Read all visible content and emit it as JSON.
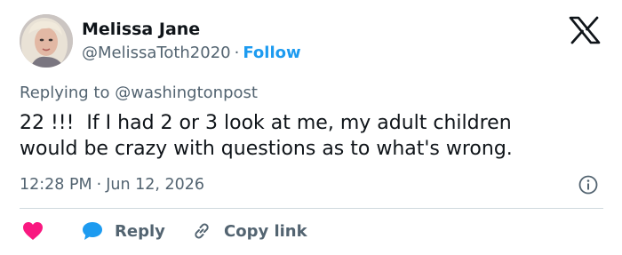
{
  "author": {
    "name": "Melissa Jane",
    "handle": "@MelissaToth2020",
    "separator": "·",
    "follow_label": "Follow"
  },
  "reply_context": {
    "prefix": "Replying to",
    "mention": "@washingtonpost"
  },
  "tweet": {
    "text": "22 !!!  If I had 2 or 3 look at me, my adult children\nwould be crazy with questions as to what's wrong."
  },
  "meta": {
    "time": "12:28 PM",
    "separator": "·",
    "date": "Jun 12, 2026"
  },
  "actions": {
    "reply_label": "Reply",
    "copy_link_label": "Copy link"
  },
  "icons": {
    "logo": "x-logo-icon",
    "info": "info-icon",
    "like": "heart-icon",
    "reply": "speech-bubble-icon",
    "copy": "link-icon"
  },
  "colors": {
    "accent": "#1d9bf0",
    "heart": "#f91880",
    "text": "#0f1419",
    "secondary": "#536471"
  }
}
